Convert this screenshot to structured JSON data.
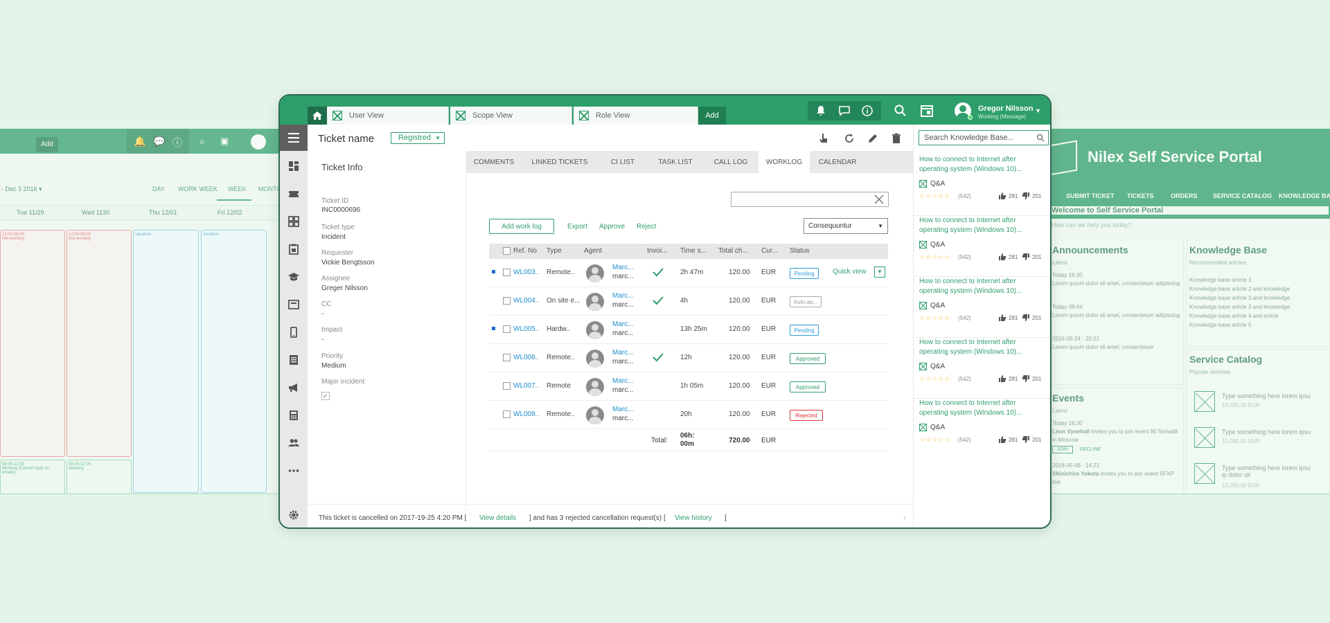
{
  "calendar_bg": {
    "add_label": "Add",
    "date_range": "- Dec 3 2016",
    "views": [
      "DAY",
      "WORK WEEK",
      "WEEK",
      "MONTH"
    ],
    "days": [
      "Tue 11/29",
      "Wed 1130",
      "Thu 12/01",
      "Fri 12/02"
    ],
    "events": [
      {
        "time": "12:00-08:00",
        "label": "Not working"
      },
      {
        "time": "12:00-08:00",
        "label": "Not working"
      },
      {
        "label": "Vacation"
      },
      {
        "label": "Vacation"
      },
      {
        "time": "08:00-12:00",
        "label": "Working (Cannot reply on emails)"
      },
      {
        "time": "08:00-12:00",
        "label": "Working"
      }
    ]
  },
  "portal_bg": {
    "title": "Nilex Self Service Portal",
    "nav": [
      "SUBMIT TICKET",
      "TICKETS",
      "ORDERS",
      "SERVICE CATALOG",
      "KNOWLEDGE BASE"
    ],
    "welcome": "Welcome to Self Service Portal",
    "help": "How can we help you today?",
    "announcements": {
      "title": "Announcements",
      "sub": "Latest",
      "items": [
        {
          "when": "Today 16:30",
          "text": "Lorem ipsum dolor sit amet, consectetuer adipiscing"
        },
        {
          "when": "Today 08:44",
          "text": "Lorem ipsum dolor sit amet, consectetuer adipiscing"
        },
        {
          "when": "2016-09-24 · 20:21",
          "text": "Lorem ipsum dolor sit amet, consectetuer"
        }
      ]
    },
    "events": {
      "title": "Events",
      "sub": "Latest",
      "items": [
        {
          "when": "Today 16:30",
          "name": "Leon Vynehall",
          "text": "invites you to join event 90 Somatik in Moscow"
        },
        {
          "when": "2016-05-06 · 14:23",
          "name": "Shinichiro Yokota",
          "text": "invites you to join event SFXP live"
        }
      ],
      "join": "JOIN",
      "decline": "DECLINE"
    },
    "kb": {
      "title": "Knowledge Base",
      "sub": "Recommended articles",
      "articles": [
        "Knowledge base article 1",
        "Knowledge base article 2 and knowledge",
        "Knowledge base article 3 and knowledge",
        "Knowledge base article 3 and knowledge",
        "Knowledge base article 4 and article",
        "Knowledge base article 5"
      ]
    },
    "catalog": {
      "title": "Service Catalog",
      "sub": "Popular services",
      "items": [
        {
          "text": "Type something here lorem ipsu",
          "price": "15,000.00 EUR"
        },
        {
          "text": "Type something here lorem ipsu",
          "price": "15,000.00 EUR"
        },
        {
          "text": "Type something here lorem ipsu ip dolor sit",
          "price": "15,000.00 EUR"
        }
      ]
    }
  },
  "tabs": [
    "User View",
    "Scope View",
    "Role View"
  ],
  "add_tab": "Add",
  "user": {
    "name": "Gregor Nilsson",
    "status": "Working (Message)"
  },
  "ticket": {
    "title": "Ticket name",
    "status": "Registred"
  },
  "info": {
    "heading": "Ticket Info",
    "fields": [
      {
        "label": "Ticket ID",
        "value": "INC0000696"
      },
      {
        "label": "Ticket type",
        "value": "Incident"
      },
      {
        "label": "Requester",
        "value": "Vickie Bengtsson"
      },
      {
        "label": "Assignee",
        "value": "Greger Nilsson"
      },
      {
        "label": "CC",
        "value": "-"
      },
      {
        "label": "Impact",
        "value": "-"
      },
      {
        "label": "Priority",
        "value": "Medium"
      }
    ],
    "major_label": "Major incident"
  },
  "section_tabs": [
    "COMMENTS",
    "LINKED TICKETS",
    "CI LIST",
    "TASK LIST",
    "CALL LOG",
    "WORKLOG",
    "CALENDAR"
  ],
  "worklog": {
    "add_btn": "Add work log",
    "export": "Export",
    "approve": "Approve",
    "reject": "Reject",
    "sort_value": "Consequuntur",
    "columns": [
      "Ref. No",
      "Type",
      "Agent",
      "Invoi...",
      "Time s...",
      "Total ch...",
      "Cur...",
      "Status"
    ],
    "rows": [
      {
        "ref": "WL003..",
        "type": "Remote..",
        "agent1": "Marc...",
        "agent2": "marc...",
        "invoiced": true,
        "time": "2h 47m",
        "total": "120.00",
        "cur": "EUR",
        "status": "Pending",
        "dot": true
      },
      {
        "ref": "WL004..",
        "type": "On site e...",
        "agent1": "Marc...",
        "agent2": "marc...",
        "invoiced": true,
        "time": "4h",
        "total": "120.00",
        "cur": "EUR",
        "status": "Auto-ap...",
        "dot": false
      },
      {
        "ref": "WL005..",
        "type": "Hardw..",
        "agent1": "Marc...",
        "agent2": "marc...",
        "invoiced": false,
        "time": "13h 25m",
        "total": "120.00",
        "cur": "EUR",
        "status": "Pending",
        "dot": true
      },
      {
        "ref": "WL006..",
        "type": "Remote..",
        "agent1": "Marc...",
        "agent2": "marc...",
        "invoiced": true,
        "time": "12h",
        "total": "120.00",
        "cur": "EUR",
        "status": "Approved",
        "dot": false
      },
      {
        "ref": "WL007..",
        "type": "Remote",
        "agent1": "Marc...",
        "agent2": "marc...",
        "invoiced": false,
        "time": "1h 05m",
        "total": "120.00",
        "cur": "EUR",
        "status": "Approved",
        "dot": false
      },
      {
        "ref": "WL008..",
        "type": "Remote..",
        "agent1": "Marc...",
        "agent2": "marc...",
        "invoiced": false,
        "time": "20h",
        "total": "120.00",
        "cur": "EUR",
        "status": "Rejected",
        "dot": false
      }
    ],
    "quick_view": "Quick view",
    "total_label": "Total:",
    "total_time_1": "06h:",
    "total_time_2": "00m",
    "total_sum": "720.00",
    "total_cur": "EUR"
  },
  "footer": {
    "text1": "This ticket is cancelled on 2017-19-25 4:20 PM [",
    "link1": "View details",
    "text2": "] and has 3 rejected cancellation request(s)  [",
    "link2": "View history",
    "text3": "]"
  },
  "kb": {
    "search_placeholder": "Search Knowledge Base...",
    "items": [
      {
        "title": "How to connect to Internet after operating system (Windows 10)...",
        "tag": "Q&A",
        "count": "(542)",
        "likes": "281",
        "dislikes": "201"
      },
      {
        "title": "How to connect to Internet after operating system (Windows 10)...",
        "tag": "Q&A",
        "count": "(542)",
        "likes": "281",
        "dislikes": "201"
      },
      {
        "title": "How to connect to Internet after operating system (Windows 10)...",
        "tag": "Q&A",
        "count": "(542)",
        "likes": "281",
        "dislikes": "201"
      },
      {
        "title": "How to connect to Internet after operating system (Windows 10)...",
        "tag": "Q&A",
        "count": "(542)",
        "likes": "281",
        "dislikes": "201"
      },
      {
        "title": "How to connect to Internet after operating system (Windows 10)...",
        "tag": "Q&A",
        "count": "(542)",
        "likes": "281",
        "dislikes": "201"
      }
    ]
  },
  "colors": {
    "brand": "#2e9e6a",
    "link": "#1d8fd0",
    "pending": "#2d9ed8",
    "rejected": "#d8333a"
  }
}
